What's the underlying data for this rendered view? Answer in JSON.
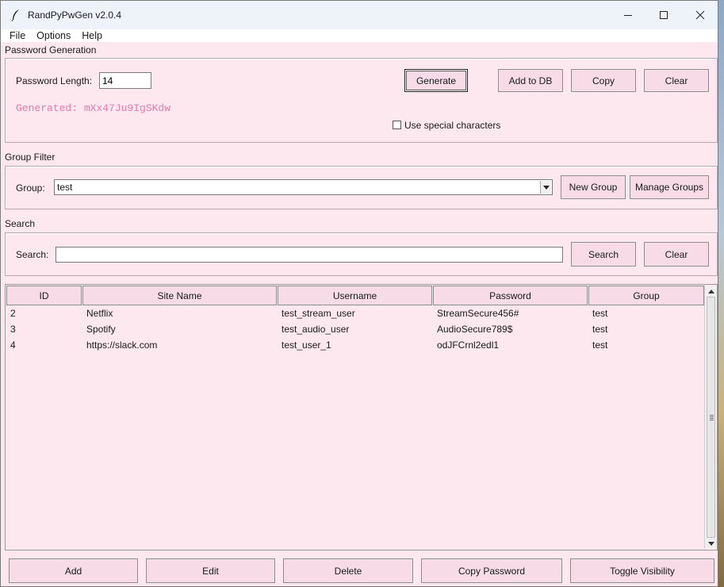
{
  "window": {
    "title": "RandPyPwGen v2.0.4"
  },
  "menu": [
    "File",
    "Options",
    "Help"
  ],
  "password_generation": {
    "section_label": "Password Generation",
    "length_label": "Password Length:",
    "length_value": "14",
    "generate_label": "Generate",
    "add_to_db_label": "Add to DB",
    "copy_label": "Copy",
    "clear_label": "Clear",
    "generated_text": "Generated: mXx47Ju9IgSKdw",
    "special_chars_label": "Use special characters",
    "special_chars_checked": false
  },
  "group_filter": {
    "section_label": "Group Filter",
    "group_label": "Group:",
    "group_value": "test",
    "new_group_label": "New Group",
    "manage_groups_label": "Manage Groups"
  },
  "search": {
    "section_label": "Search",
    "search_label": "Search:",
    "search_value": "",
    "search_button_label": "Search",
    "clear_label": "Clear"
  },
  "table": {
    "columns": [
      "ID",
      "Site Name",
      "Username",
      "Password",
      "Group"
    ],
    "rows": [
      [
        "2",
        "Netflix",
        "test_stream_user",
        "StreamSecure456#",
        "test"
      ],
      [
        "3",
        "Spotify",
        "test_audio_user",
        "AudioSecure789$",
        "test"
      ],
      [
        "4",
        "https://slack.com",
        "test_user_1",
        "odJFCrnl2edl1",
        "test"
      ]
    ]
  },
  "actions": {
    "add_label": "Add",
    "edit_label": "Edit",
    "delete_label": "Delete",
    "copy_password_label": "Copy Password",
    "toggle_visibility_label": "Toggle Visibility"
  },
  "colors": {
    "window_bg": "#fde8ef",
    "button_bg": "#f7dbe6",
    "generated_text": "#e87aa6"
  }
}
